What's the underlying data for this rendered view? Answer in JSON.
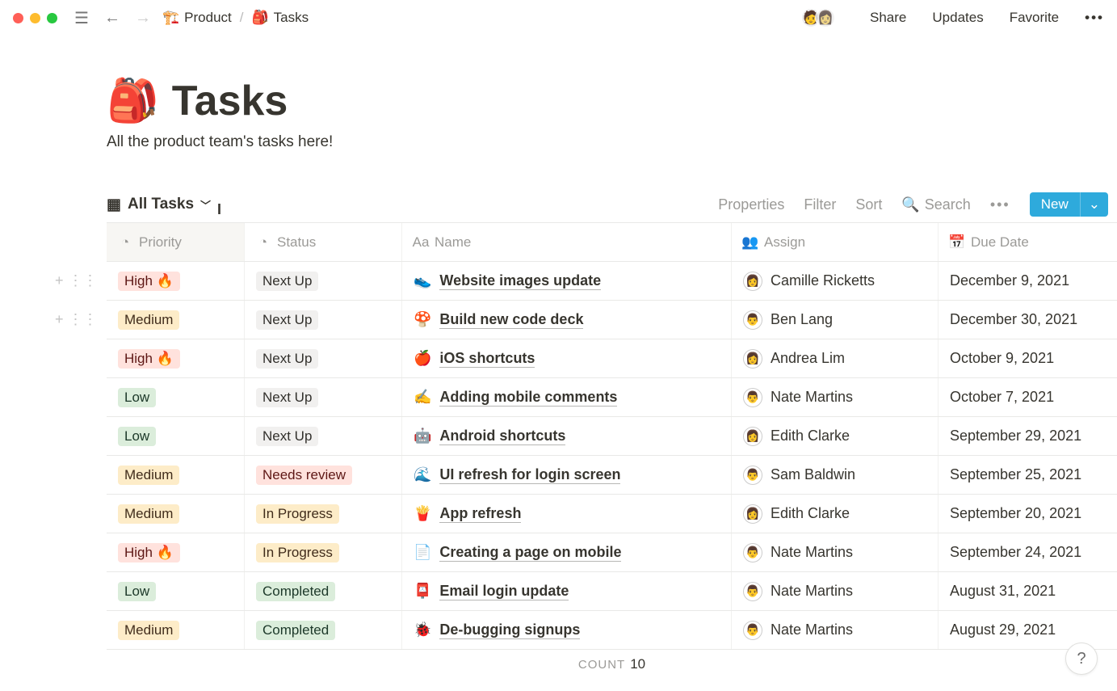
{
  "breadcrumb": {
    "parent_icon": "🏗️",
    "parent": "Product",
    "sep": "/",
    "page_icon": "🎒",
    "page": "Tasks"
  },
  "topnav": {
    "share": "Share",
    "updates": "Updates",
    "favorite": "Favorite"
  },
  "page": {
    "icon": "🎒",
    "title": "Tasks",
    "subtitle": "All the product team's tasks here!"
  },
  "view": {
    "name": "All Tasks"
  },
  "toolbar": {
    "properties": "Properties",
    "filter": "Filter",
    "sort": "Sort",
    "search": "Search",
    "new": "New"
  },
  "columns": {
    "priority": "Priority",
    "status": "Status",
    "name": "Name",
    "assign": "Assign",
    "due": "Due Date"
  },
  "footer": {
    "label": "COUNT",
    "value": "10"
  },
  "priority_tags": {
    "High": "High 🔥",
    "Medium": "Medium",
    "Low": "Low"
  },
  "status_tags": {
    "Next Up": "Next Up",
    "Needs review": "Needs review",
    "In Progress": "In Progress",
    "Completed": "Completed"
  },
  "rows": [
    {
      "priority": "High",
      "status": "Next Up",
      "icon": "👟",
      "name": "Website images update",
      "assign": "Camille Ricketts",
      "avatar": "👩",
      "due": "December 9, 2021",
      "hover": true
    },
    {
      "priority": "Medium",
      "status": "Next Up",
      "icon": "🍄",
      "name": "Build new code deck",
      "assign": "Ben Lang",
      "avatar": "👨",
      "due": "December 30, 2021",
      "hover": true
    },
    {
      "priority": "High",
      "status": "Next Up",
      "icon": "🍎",
      "name": "iOS shortcuts",
      "assign": "Andrea Lim",
      "avatar": "👩",
      "due": "October 9, 2021"
    },
    {
      "priority": "Low",
      "status": "Next Up",
      "icon": "✍️",
      "name": "Adding mobile comments",
      "assign": "Nate Martins",
      "avatar": "👨",
      "due": "October 7, 2021"
    },
    {
      "priority": "Low",
      "status": "Next Up",
      "icon": "🤖",
      "name": "Android shortcuts",
      "assign": "Edith Clarke",
      "avatar": "👩",
      "due": "September 29, 2021"
    },
    {
      "priority": "Medium",
      "status": "Needs review",
      "icon": "🌊",
      "name": "UI refresh for login screen",
      "assign": "Sam Baldwin",
      "avatar": "👨",
      "due": "September 25, 2021"
    },
    {
      "priority": "Medium",
      "status": "In Progress",
      "icon": "🍟",
      "name": "App refresh",
      "assign": "Edith Clarke",
      "avatar": "👩",
      "due": "September 20, 2021"
    },
    {
      "priority": "High",
      "status": "In Progress",
      "icon": "📄",
      "name": "Creating a page on mobile",
      "assign": "Nate Martins",
      "avatar": "👨",
      "due": "September 24, 2021"
    },
    {
      "priority": "Low",
      "status": "Completed",
      "icon": "📮",
      "name": "Email login update",
      "assign": "Nate Martins",
      "avatar": "👨",
      "due": "August 31, 2021"
    },
    {
      "priority": "Medium",
      "status": "Completed",
      "icon": "🐞",
      "name": "De-bugging signups",
      "assign": "Nate Martins",
      "avatar": "👨",
      "due": "August 29, 2021"
    }
  ]
}
